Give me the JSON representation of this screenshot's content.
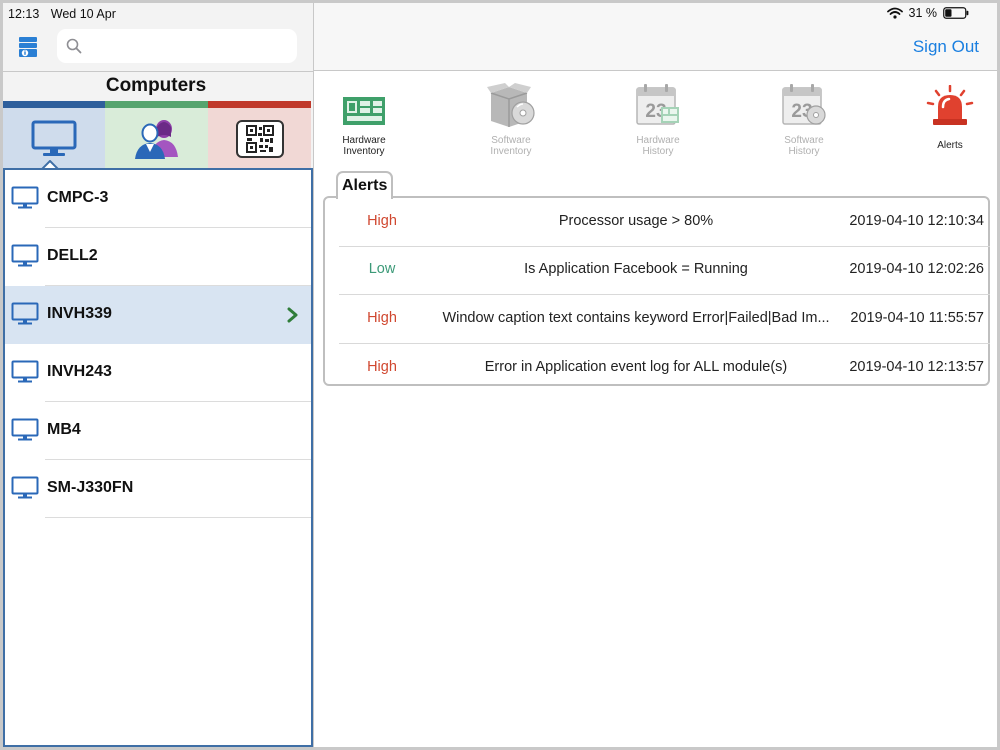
{
  "status_bar": {
    "time": "12:13",
    "date": "Wed 10 Apr",
    "battery": "31 %"
  },
  "search": {
    "placeholder": "",
    "value": ""
  },
  "left_panel": {
    "title": "Computers",
    "tabs": [
      {
        "name": "computers",
        "icon": "monitor-icon",
        "selected": true
      },
      {
        "name": "users",
        "icon": "users-icon",
        "selected": false
      },
      {
        "name": "qr",
        "icon": "qr-code-icon",
        "selected": false
      }
    ],
    "computers": [
      {
        "name": "CMPC-3",
        "selected": false
      },
      {
        "name": "DELL2",
        "selected": false
      },
      {
        "name": "INVH339",
        "selected": true
      },
      {
        "name": "INVH243",
        "selected": false
      },
      {
        "name": "MB4",
        "selected": false
      },
      {
        "name": "SM-J330FN",
        "selected": false
      }
    ]
  },
  "header": {
    "sign_out": "Sign Out"
  },
  "toolbar": [
    {
      "label_line1": "Hardware",
      "label_line2": "Inventory",
      "icon": "hardware-board-icon",
      "enabled": true
    },
    {
      "label_line1": "Software",
      "label_line2": "Inventory",
      "icon": "software-box-icon",
      "enabled": false
    },
    {
      "label_line1": "Hardware",
      "label_line2": "History",
      "icon": "calendar-hardware-icon",
      "enabled": false
    },
    {
      "label_line1": "Software",
      "label_line2": "History",
      "icon": "calendar-software-icon",
      "enabled": false
    },
    {
      "label_line1": "Alerts",
      "label_line2": "",
      "icon": "siren-icon",
      "enabled": true
    }
  ],
  "alerts": {
    "tab_label": "Alerts",
    "rows": [
      {
        "severity": "High",
        "message": "Processor usage > 80%",
        "timestamp": "2019-04-10 12:10:34"
      },
      {
        "severity": "Low",
        "message": "Is Application Facebook = Running",
        "timestamp": "2019-04-10 12:02:26"
      },
      {
        "severity": "High",
        "message": "Window caption text contains keyword Error|Failed|Bad Im...",
        "timestamp": "2019-04-10 11:55:57"
      },
      {
        "severity": "High",
        "message": "Error in Application event log for ALL module(s)",
        "timestamp": "2019-04-10 12:13:57"
      }
    ]
  },
  "colors": {
    "accent_blue": "#1a7fe0",
    "tab_bar_blue": "#2e5f9c",
    "tab_bar_green": "#56a46e",
    "tab_bar_red": "#c0392b",
    "severity_high": "#d0472f",
    "severity_low": "#3c9a78"
  }
}
